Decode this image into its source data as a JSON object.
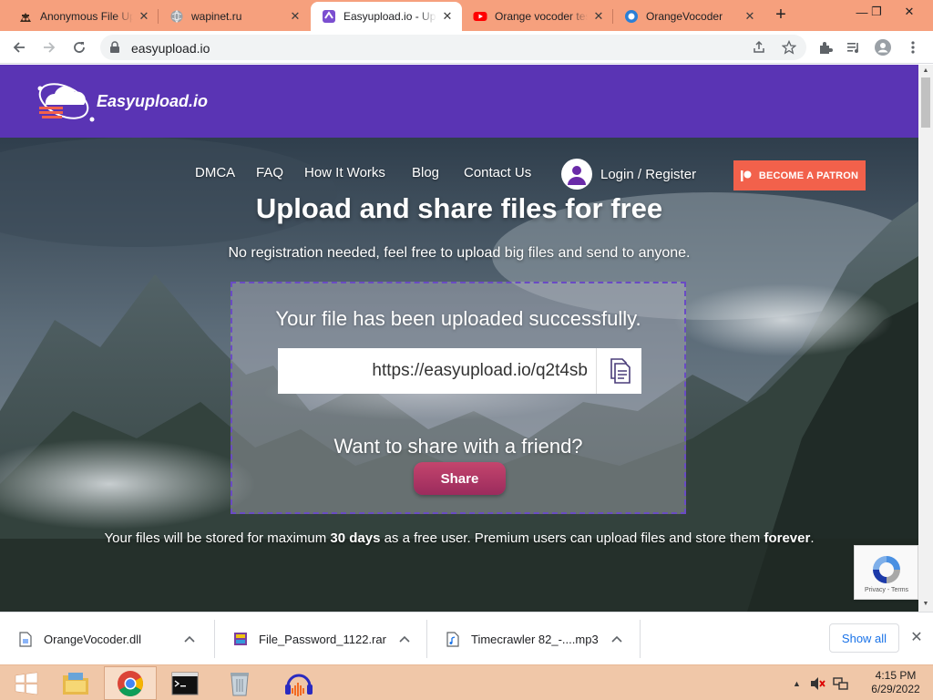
{
  "browser": {
    "tabs": [
      {
        "title": "Anonymous File Upload",
        "favicon": "anon-icon",
        "active": false
      },
      {
        "title": "wapinet.ru",
        "favicon": "globe-icon",
        "active": false
      },
      {
        "title": "Easyupload.io - Upload",
        "favicon": "easyupload-icon",
        "active": true
      },
      {
        "title": "Orange vocoder test",
        "favicon": "youtube-icon",
        "active": false
      },
      {
        "title": "OrangeVocoder",
        "favicon": "orange-icon",
        "active": false
      }
    ],
    "new_tab_label": "+",
    "address": "easyupload.io",
    "window_controls": {
      "minimize": "—",
      "restore": "❐",
      "close": "✕"
    }
  },
  "site": {
    "logo_text": "Easyupload.io",
    "brand_color": "#5a34b4",
    "nav": [
      {
        "label": "DMCA"
      },
      {
        "label": "FAQ"
      },
      {
        "label": "How It Works"
      },
      {
        "label": "Blog"
      },
      {
        "label": "Contact Us"
      }
    ],
    "login_label": "Login / Register",
    "patron_label": "BECOME A PATRON",
    "headline": "Upload and share files for free",
    "subheadline": "No registration needed, feel free to upload big files and send to anyone.",
    "upload": {
      "success_text": "Your file has been uploaded successfully.",
      "link_value": "https://easyupload.io/q2t4sb",
      "share_question": "Want to share with a friend?",
      "share_label": "Share"
    },
    "notice": {
      "pre": "Your files will be stored for maximum ",
      "days": "30 days",
      "mid": " as a free user. Premium users can upload files and store them ",
      "forever": "forever",
      "post": "."
    },
    "recaptcha": {
      "links": "Privacy - Terms"
    }
  },
  "downloads": {
    "items": [
      {
        "name": "OrangeVocoder.dll",
        "icon": "file-icon"
      },
      {
        "name": "File_Password_1122.rar",
        "icon": "archive-icon"
      },
      {
        "name": "Timecrawler 82_-....mp3",
        "icon": "audio-file-icon"
      }
    ],
    "show_all_label": "Show all"
  },
  "taskbar": {
    "apps": [
      "windows-start",
      "file-explorer",
      "chrome",
      "command-prompt",
      "recycle-app",
      "audacity"
    ],
    "time": "4:15 PM",
    "date": "6/29/2022"
  }
}
